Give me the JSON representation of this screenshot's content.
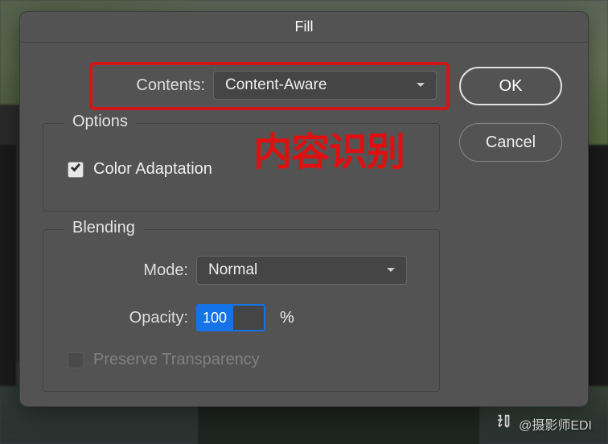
{
  "dialog": {
    "title": "Fill"
  },
  "contents": {
    "label": "Contents:",
    "value": "Content-Aware"
  },
  "buttons": {
    "ok": "OK",
    "cancel": "Cancel"
  },
  "options": {
    "legend": "Options",
    "color_adaptation": {
      "label": "Color Adaptation",
      "checked": true
    }
  },
  "annotation": {
    "text": "内容识别"
  },
  "blending": {
    "legend": "Blending",
    "mode": {
      "label": "Mode:",
      "value": "Normal"
    },
    "opacity": {
      "label": "Opacity:",
      "value": "100",
      "unit": "%"
    },
    "preserve_transparency": {
      "label": "Preserve Transparency",
      "checked": false,
      "disabled": true
    }
  },
  "watermark": {
    "text": "@摄影师EDI"
  }
}
